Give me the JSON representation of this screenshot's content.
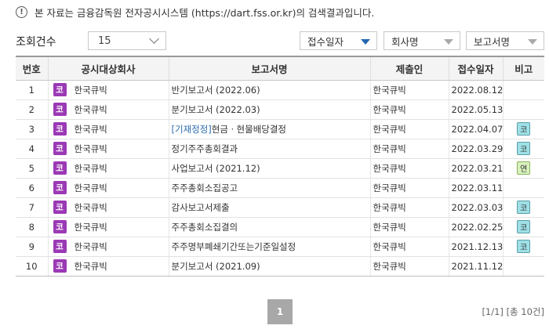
{
  "notice": {
    "icon": "info-icon",
    "text": "본 자료는 금융감독원 전자공시시스템 (https://dart.fss.or.kr)의 검색결과입니다."
  },
  "toolbar": {
    "count_label": "조회건수",
    "count_value": "15",
    "sort_options": [
      "접수일자",
      "회사명",
      "보고서명"
    ],
    "active_sort": "접수일자"
  },
  "table": {
    "headers": [
      "번호",
      "공시대상회사",
      "보고서명",
      "제출인",
      "접수일자",
      "비고"
    ],
    "rows": [
      {
        "num": "1",
        "badge": "코",
        "company": "한국큐빅",
        "report_prefix": "",
        "report": "반기보고서 (2022.06)",
        "submitter": "한국큐빅",
        "date": "2022.08.12",
        "note": ""
      },
      {
        "num": "2",
        "badge": "코",
        "company": "한국큐빅",
        "report_prefix": "",
        "report": "분기보고서 (2022.03)",
        "submitter": "한국큐빅",
        "date": "2022.05.13",
        "note": ""
      },
      {
        "num": "3",
        "badge": "코",
        "company": "한국큐빅",
        "report_prefix": "[기재정정]",
        "report": "현금ㆍ현물배당결정",
        "submitter": "한국큐빅",
        "date": "2022.04.07",
        "note": "코"
      },
      {
        "num": "4",
        "badge": "코",
        "company": "한국큐빅",
        "report_prefix": "",
        "report": "정기주주총회결과",
        "submitter": "한국큐빅",
        "date": "2022.03.29",
        "note": "코"
      },
      {
        "num": "5",
        "badge": "코",
        "company": "한국큐빅",
        "report_prefix": "",
        "report": "사업보고서 (2021.12)",
        "submitter": "한국큐빅",
        "date": "2022.03.21",
        "note": "연"
      },
      {
        "num": "6",
        "badge": "코",
        "company": "한국큐빅",
        "report_prefix": "",
        "report": "주주총회소집공고",
        "submitter": "한국큐빅",
        "date": "2022.03.11",
        "note": ""
      },
      {
        "num": "7",
        "badge": "코",
        "company": "한국큐빅",
        "report_prefix": "",
        "report": "감사보고서제출",
        "submitter": "한국큐빅",
        "date": "2022.03.03",
        "note": "코"
      },
      {
        "num": "8",
        "badge": "코",
        "company": "한국큐빅",
        "report_prefix": "",
        "report": "주주총회소집결의",
        "submitter": "한국큐빅",
        "date": "2022.02.25",
        "note": "코"
      },
      {
        "num": "9",
        "badge": "코",
        "company": "한국큐빅",
        "report_prefix": "",
        "report": "주주명부폐쇄기간또는기준일설정",
        "submitter": "한국큐빅",
        "date": "2021.12.13",
        "note": "코"
      },
      {
        "num": "10",
        "badge": "코",
        "company": "한국큐빅",
        "report_prefix": "",
        "report": "분기보고서 (2021.09)",
        "submitter": "한국큐빅",
        "date": "2021.11.12",
        "note": ""
      }
    ]
  },
  "pagination": {
    "current_page": "1",
    "summary": "[1/1] [총 10건]"
  },
  "colors": {
    "corp_badge": "#9b39b5",
    "kospi_note": "#9ee0e6",
    "yeon_note": "#d8f0bd",
    "correction_link": "#2b6cb0",
    "active_sort_arrow": "#2566b0"
  }
}
